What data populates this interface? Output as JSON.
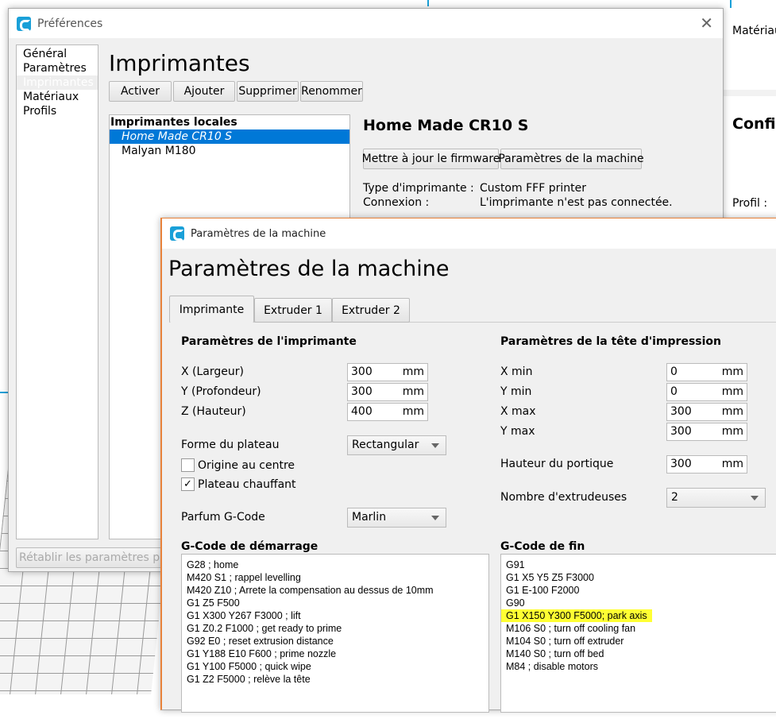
{
  "background": {
    "right_panel": {
      "material_label": "Matériau",
      "config_heading": "Confi",
      "profile_label": "Profil :"
    }
  },
  "preferences": {
    "title": "Préférences",
    "sidebar": [
      "Général",
      "Paramètres",
      "Imprimantes",
      "Matériaux",
      "Profils"
    ],
    "selected_sidebar": "Imprimantes",
    "heading": "Imprimantes",
    "buttons": {
      "activate": "Activer",
      "add": "Ajouter",
      "remove": "Supprimer",
      "rename": "Renommer"
    },
    "printer_list": {
      "group": "Imprimantes locales",
      "items": [
        "Home Made CR10 S",
        "Malyan M180"
      ]
    },
    "printer_name": "Home Made CR10 S",
    "update_firmware": "Mettre à jour le firmware",
    "machine_settings": "Paramètres de la machine",
    "info": [
      {
        "label": "Type d'imprimante :",
        "value": "Custom FFF printer"
      },
      {
        "label": "Connexion :",
        "value": "L'imprimante n'est pas connectée."
      }
    ],
    "reset_button": "Rétablir les paramètres par"
  },
  "machine": {
    "title": "Paramètres de la machine",
    "heading": "Paramètres de la machine",
    "tabs": [
      "Imprimante",
      "Extruder 1",
      "Extruder 2"
    ],
    "printer_section": "Paramètres de l'imprimante",
    "unit": "mm",
    "dims": [
      {
        "label": "X (Largeur)",
        "value": "300"
      },
      {
        "label": "Y (Profondeur)",
        "value": "300"
      },
      {
        "label": "Z (Hauteur)",
        "value": "400"
      }
    ],
    "bed_shape": {
      "label": "Forme du plateau",
      "value": "Rectangular"
    },
    "origin_center": {
      "label": "Origine au centre",
      "checked": false
    },
    "heated_bed": {
      "label": "Plateau chauffant",
      "checked": true,
      "mark": "✓"
    },
    "gcode_flavor": {
      "label": "Parfum G-Code",
      "value": "Marlin"
    },
    "head_section": "Paramètres de la tête d'impression",
    "head": [
      {
        "label": "X min",
        "value": "0"
      },
      {
        "label": "Y min",
        "value": "0"
      },
      {
        "label": "X max",
        "value": "300"
      },
      {
        "label": "Y max",
        "value": "300"
      }
    ],
    "gantry": {
      "label": "Hauteur du portique",
      "value": "300"
    },
    "extruders": {
      "label": "Nombre d'extrudeuses",
      "value": "2"
    },
    "start_gcode": {
      "label": "G-Code de démarrage",
      "lines": [
        "G28 ; home",
        "M420 S1 ; rappel levelling",
        "M420 Z10 ; Arrete la compensation au dessus de 10mm",
        "G1 Z5 F500",
        "G1 X300 Y267 F3000 ; lift",
        "G1 Z0.2 F1000 ; get ready to prime",
        "G92 E0 ; reset extrusion distance",
        "G1 Y188 E10 F600 ; prime nozzle",
        "G1 Y100 F5000 ; quick wipe",
        "G1 Z2 F5000 ; relève la tête"
      ]
    },
    "end_gcode": {
      "label": "G-Code de fin",
      "lines": [
        "G91",
        "G1 X5 Y5 Z5 F3000",
        "G1 E-100 F2000",
        "G90",
        "G1 X150 Y300 F5000; park axis",
        "M106 S0 ; turn off cooling fan",
        "M104 S0 ; turn off extruder",
        "M140 S0 ; turn off bed",
        "M84 ; disable motors"
      ],
      "highlight_line": 4
    }
  },
  "colors": {
    "accent": "#0078d7",
    "highlight": "#ffff33",
    "dialog_border": "#e8823a"
  }
}
